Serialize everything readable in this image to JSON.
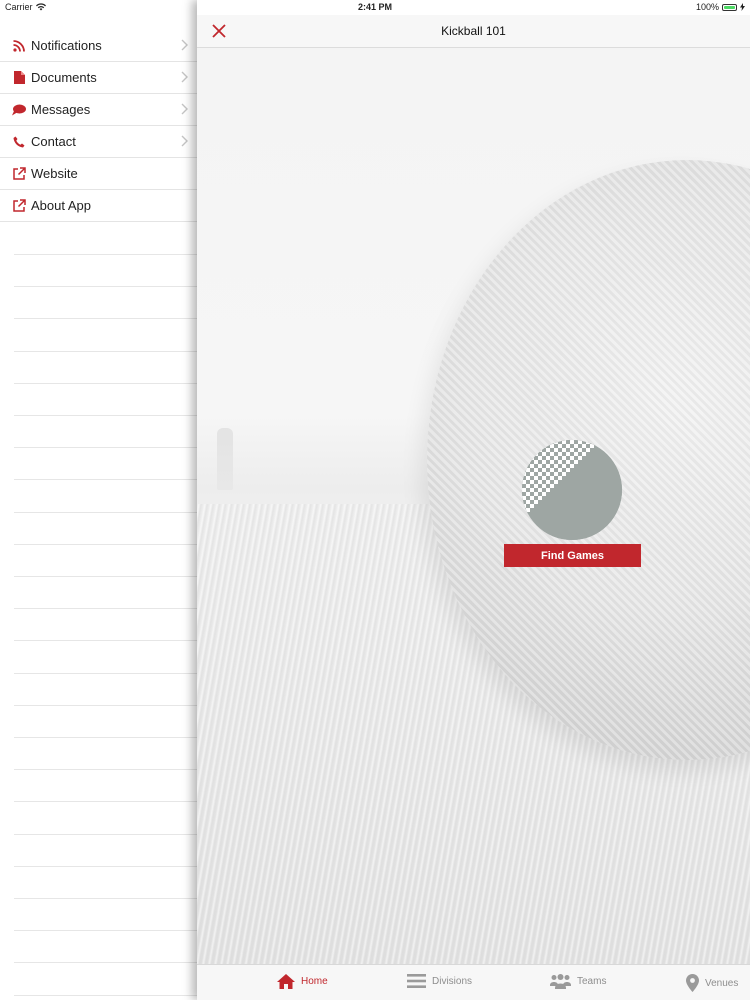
{
  "status_bar": {
    "carrier": "Carrier",
    "time": "2:41 PM",
    "battery": "100%"
  },
  "sidebar": {
    "items": [
      {
        "label": "Notifications",
        "icon": "rss-icon",
        "has_chevron": true
      },
      {
        "label": "Documents",
        "icon": "document-icon",
        "has_chevron": true
      },
      {
        "label": "Messages",
        "icon": "chat-bubble-icon",
        "has_chevron": true
      },
      {
        "label": "Contact",
        "icon": "phone-icon",
        "has_chevron": true
      },
      {
        "label": "Website",
        "icon": "external-link-icon",
        "has_chevron": false
      },
      {
        "label": "About App",
        "icon": "external-link-icon",
        "has_chevron": false
      }
    ]
  },
  "header": {
    "title": "Kickball 101",
    "close_icon": "close-icon"
  },
  "hero": {
    "find_games_label": "Find Games"
  },
  "tabbar": {
    "tabs": [
      {
        "label": "Home",
        "icon": "home-icon",
        "active": true
      },
      {
        "label": "Divisions",
        "icon": "list-icon",
        "active": false
      },
      {
        "label": "Teams",
        "icon": "people-icon",
        "active": false
      },
      {
        "label": "Venues",
        "icon": "map-pin-icon",
        "active": false
      }
    ]
  },
  "colors": {
    "accent": "#c1272d",
    "inactive_tab": "#8e8e8e",
    "separator": "#e4e4e4"
  }
}
